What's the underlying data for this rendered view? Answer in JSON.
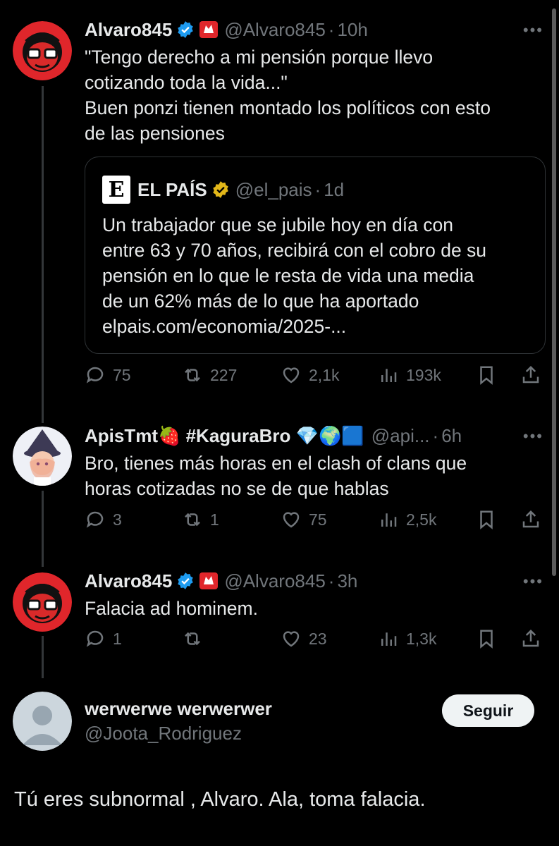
{
  "posts": [
    {
      "name": "Alvaro845",
      "handle": "@Alvaro845",
      "time": "10h",
      "text_lines": [
        "\"Tengo derecho a mi pensión porque llevo",
        "cotizando toda la vida...\"",
        "Buen ponzi tienen montado los políticos con esto",
        "de las pensiones"
      ],
      "quote": {
        "logo": "E",
        "name": "EL PAÍS",
        "handle": "@el_pais",
        "time": "1d",
        "text_lines": [
          "Un trabajador que se jubile hoy en día con",
          "entre 63 y 70 años, recibirá con el cobro de su",
          "pensión en lo que le resta de vida una media",
          "de un 62% más de lo que ha aportado",
          "elpais.com/economia/2025-..."
        ]
      },
      "stats": {
        "replies": "75",
        "reposts": "227",
        "likes": "2,1k",
        "views": "193k"
      }
    },
    {
      "name": "ApisTmt🍓 #KaguraBro 💎🌍🟦",
      "handle": "@api...",
      "time": "6h",
      "text_lines": [
        "Bro, tienes más horas en el clash of clans que",
        "horas cotizadas no se de que hablas"
      ],
      "stats": {
        "replies": "3",
        "reposts": "1",
        "likes": "75",
        "views": "2,5k"
      }
    },
    {
      "name": "Alvaro845",
      "handle": "@Alvaro845",
      "time": "3h",
      "text_lines": [
        "Falacia ad hominem."
      ],
      "stats": {
        "replies": "1",
        "reposts": "",
        "likes": "23",
        "views": "1,3k"
      }
    }
  ],
  "focus": {
    "name": "werwerwe werwerwer",
    "handle": "@Joota_Rodriguez",
    "follow_label": "Seguir",
    "text": "Tú eres subnormal , Alvaro. Ala, toma falacia."
  },
  "colors": {
    "background": "#000000",
    "text": "#e7e9ea",
    "muted": "#71767b",
    "verified_blue": "#1d9bf0",
    "verified_gold": "#e2b719"
  },
  "icons": [
    "more-icon",
    "verified-blue-icon",
    "verified-gold-icon",
    "reply-icon",
    "repost-icon",
    "like-icon",
    "views-icon",
    "bookmark-icon",
    "share-icon"
  ]
}
